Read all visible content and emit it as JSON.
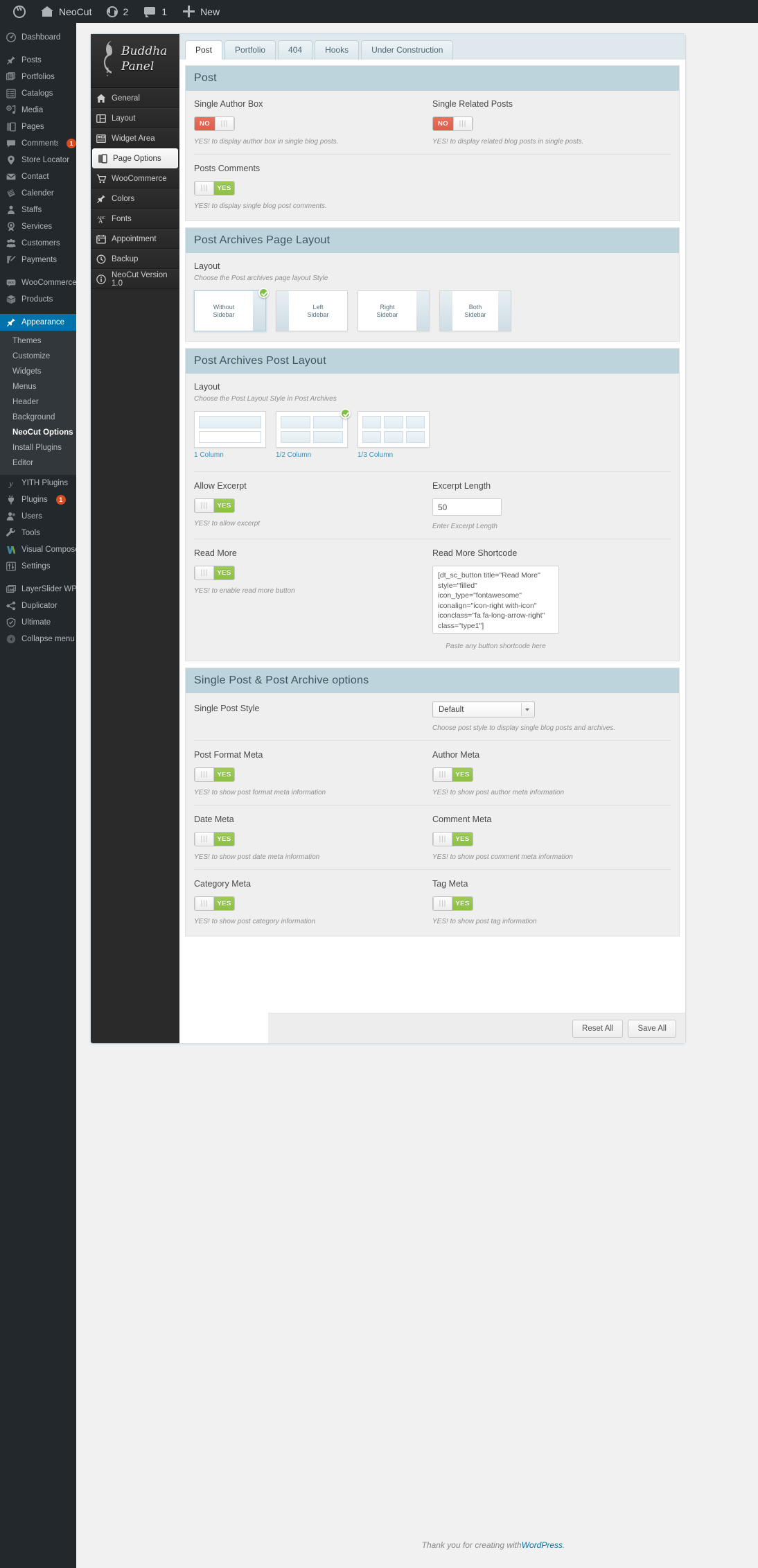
{
  "adminbar": {
    "items": [
      {
        "icon": "wordpress-logo-icon",
        "label": ""
      },
      {
        "icon": "home-icon",
        "label": "NeoCut"
      },
      {
        "icon": "updates-icon",
        "label": "2"
      },
      {
        "icon": "comment-icon",
        "label": "1"
      },
      {
        "icon": "plus-icon",
        "label": "New"
      }
    ]
  },
  "adminmenu": {
    "items": [
      {
        "label": "Dashboard",
        "icon": "dashboard-icon",
        "badge": null,
        "sep_before": false
      },
      {
        "label": "Posts",
        "icon": "pin-icon",
        "badge": null,
        "sep_before": true
      },
      {
        "label": "Portfolios",
        "icon": "portfolio-icon",
        "badge": null,
        "sep_before": false
      },
      {
        "label": "Catalogs",
        "icon": "list-icon",
        "badge": null,
        "sep_before": false
      },
      {
        "label": "Media",
        "icon": "media-icon",
        "badge": null,
        "sep_before": false
      },
      {
        "label": "Pages",
        "icon": "pages-icon",
        "badge": null,
        "sep_before": false
      },
      {
        "label": "Comments",
        "icon": "comment-icon",
        "badge": "1",
        "sep_before": false
      },
      {
        "label": "Store Locator",
        "icon": "map-pin-icon",
        "badge": null,
        "sep_before": false
      },
      {
        "label": "Contact",
        "icon": "envelope-icon",
        "badge": null,
        "sep_before": false
      },
      {
        "label": "Calender",
        "icon": "calendar-icon",
        "badge": null,
        "sep_before": false
      },
      {
        "label": "Staffs",
        "icon": "user-icon",
        "badge": null,
        "sep_before": false
      },
      {
        "label": "Services",
        "icon": "award-icon",
        "badge": null,
        "sep_before": false
      },
      {
        "label": "Customers",
        "icon": "group-icon",
        "badge": null,
        "sep_before": false
      },
      {
        "label": "Payments",
        "icon": "edit-icon",
        "badge": null,
        "sep_before": false
      },
      {
        "label": "WooCommerce",
        "icon": "woo-icon",
        "badge": null,
        "sep_before": true
      },
      {
        "label": "Products",
        "icon": "box-icon",
        "badge": null,
        "sep_before": false
      }
    ],
    "appearance": {
      "label": "Appearance",
      "icon": "appearance-brush-icon",
      "current": true,
      "submenu": [
        {
          "label": "Themes",
          "current": false
        },
        {
          "label": "Customize",
          "current": false
        },
        {
          "label": "Widgets",
          "current": false
        },
        {
          "label": "Menus",
          "current": false
        },
        {
          "label": "Header",
          "current": false
        },
        {
          "label": "Background",
          "current": false
        },
        {
          "label": "NeoCut Options",
          "current": true
        },
        {
          "label": "Install Plugins",
          "current": false
        },
        {
          "label": "Editor",
          "current": false
        }
      ]
    },
    "items_after": [
      {
        "label": "YITH Plugins",
        "icon": "yith-icon",
        "badge": null,
        "sep_before": false
      },
      {
        "label": "Plugins",
        "icon": "plug-icon",
        "badge": "1",
        "sep_before": false
      },
      {
        "label": "Users",
        "icon": "users-icon",
        "badge": null,
        "sep_before": false
      },
      {
        "label": "Tools",
        "icon": "wrench-icon",
        "badge": null,
        "sep_before": false
      },
      {
        "label": "Visual Composer",
        "icon": "visual-composer-icon",
        "badge": null,
        "sep_before": false
      },
      {
        "label": "Settings",
        "icon": "settings-sliders-icon",
        "badge": null,
        "sep_before": false
      },
      {
        "label": "LayerSlider WP",
        "icon": "layerslider-icon",
        "badge": null,
        "sep_before": true
      },
      {
        "label": "Duplicator",
        "icon": "share-icon",
        "badge": null,
        "sep_before": false
      },
      {
        "label": "Ultimate",
        "icon": "shield-icon",
        "badge": null,
        "sep_before": false
      },
      {
        "label": "Collapse menu",
        "icon": "collapse-arrow-icon",
        "badge": null,
        "sep_before": false
      }
    ]
  },
  "panel": {
    "logo": {
      "line1": "Buddha",
      "line2": "Panel"
    },
    "nav": [
      {
        "label": "General",
        "icon": "home-icon",
        "active": false
      },
      {
        "label": "Layout",
        "icon": "layout-icon",
        "active": false
      },
      {
        "label": "Widget Area",
        "icon": "widget-icon",
        "active": false
      },
      {
        "label": "Page Options",
        "icon": "page-options-icon",
        "active": true
      },
      {
        "label": "WooCommerce",
        "icon": "cart-icon",
        "active": false
      },
      {
        "label": "Colors",
        "icon": "brush-icon",
        "active": false
      },
      {
        "label": "Fonts",
        "icon": "fonts-icon",
        "active": false
      },
      {
        "label": "Appointment",
        "icon": "appointment-icon",
        "active": false
      },
      {
        "label": "Backup",
        "icon": "backup-icon",
        "active": false
      },
      {
        "label": "NeoCut Version 1.0",
        "icon": "info-icon",
        "active": false
      }
    ],
    "tabs": [
      {
        "label": "Post",
        "active": true
      },
      {
        "label": "Portfolio",
        "active": false
      },
      {
        "label": "404",
        "active": false
      },
      {
        "label": "Hooks",
        "active": false
      },
      {
        "label": "Under Construction",
        "active": false
      }
    ],
    "sections": {
      "post": {
        "title": "Post",
        "single_author_box": {
          "label": "Single Author Box",
          "state": "NO",
          "desc": "YES! to display author box in single blog posts."
        },
        "single_related_posts": {
          "label": "Single Related Posts",
          "state": "NO",
          "desc": "YES! to display related blog posts in single posts."
        },
        "posts_comments": {
          "label": "Posts Comments",
          "state": "YES",
          "desc": "YES! to display single blog post comments."
        }
      },
      "archives_page_layout": {
        "title": "Post Archives Page Layout",
        "label": "Layout",
        "desc": "Choose the Post archives page layout Style",
        "options": [
          {
            "line1": "Without",
            "line2": "Sidebar",
            "selected": true,
            "bars": "right"
          },
          {
            "line1": "Left",
            "line2": "Sidebar",
            "selected": false,
            "bars": "left"
          },
          {
            "line1": "Right",
            "line2": "Sidebar",
            "selected": false,
            "bars": "right"
          },
          {
            "line1": "Both",
            "line2": "Sidebar",
            "selected": false,
            "bars": "both"
          }
        ]
      },
      "archives_post_layout": {
        "title": "Post Archives Post Layout",
        "label": "Layout",
        "desc": "Choose the Post Layout Style in Post Archives",
        "options": [
          {
            "caption": "1 Column",
            "cols": 1,
            "selected": false
          },
          {
            "caption": "1/2 Column",
            "cols": 2,
            "selected": true
          },
          {
            "caption": "1/3 Column",
            "cols": 3,
            "selected": false
          }
        ],
        "allow_excerpt": {
          "label": "Allow Excerpt",
          "state": "YES",
          "desc": "YES! to allow excerpt"
        },
        "excerpt_length": {
          "label": "Excerpt Length",
          "value": "50",
          "desc": "Enter Excerpt Length"
        },
        "read_more": {
          "label": "Read More",
          "state": "YES",
          "desc": "YES! to enable read more button"
        },
        "read_more_shortcode": {
          "label": "Read More Shortcode",
          "value": "[dt_sc_button title=\"Read More\" style=\"filled\" icon_type=\"fontawesome\" iconalign=\"icon-right with-icon\" iconclass=\"fa fa-long-arrow-right\" class=\"type1\"]",
          "desc": "Paste any button shortcode here"
        }
      },
      "single_post_archive": {
        "title": "Single Post & Post Archive options",
        "single_post_style": {
          "label": "Single Post Style",
          "value": "Default",
          "desc": "Choose post style to display single blog posts and archives."
        },
        "metas": [
          {
            "label": "Post Format Meta",
            "state": "YES",
            "desc": "YES! to show post format meta information"
          },
          {
            "label": "Author Meta",
            "state": "YES",
            "desc": "YES! to show post author meta information"
          },
          {
            "label": "Date Meta",
            "state": "YES",
            "desc": "YES! to show post date meta information"
          },
          {
            "label": "Comment Meta",
            "state": "YES",
            "desc": "YES! to show post comment meta information"
          },
          {
            "label": "Category Meta",
            "state": "YES",
            "desc": "YES! to show post category information"
          },
          {
            "label": "Tag Meta",
            "state": "YES",
            "desc": "YES! to show post tag information"
          }
        ]
      }
    },
    "footer": {
      "reset_label": "Reset All",
      "save_label": "Save All"
    }
  },
  "wpfooter": {
    "text_before": "Thank you for creating with ",
    "link": "WordPress",
    "text_after": "."
  },
  "colors": {
    "wp_dark": "#23282d",
    "wp_blue": "#0073aa",
    "badge_orange": "#d54e21",
    "toggle_green": "#8dc044",
    "toggle_red": "#dd5f4b",
    "section_head": "#bed4dd",
    "link_blue": "#3a8fb7"
  }
}
